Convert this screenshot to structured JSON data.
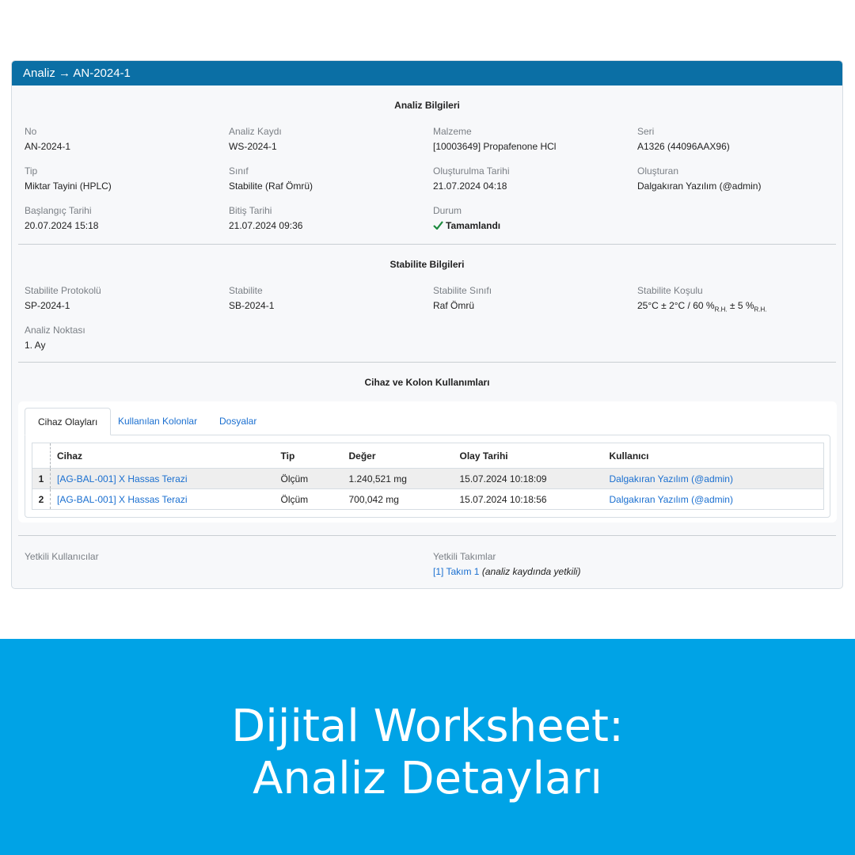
{
  "header": {
    "title": "Analiz → AN-2024-1"
  },
  "analysis_info": {
    "section_title": "Analiz Bilgileri",
    "fields": [
      {
        "label": "No",
        "value": "AN-2024-1"
      },
      {
        "label": "Analiz Kaydı",
        "value": "WS-2024-1"
      },
      {
        "label": "Malzeme",
        "value": "[10003649] Propafenone HCl"
      },
      {
        "label": "Seri",
        "value": "A1326 (44096AAX96)"
      },
      {
        "label": "Tip",
        "value": "Miktar Tayini (HPLC)"
      },
      {
        "label": "Sınıf",
        "value": "Stabilite (Raf Ömrü)"
      },
      {
        "label": "Oluşturulma Tarihi",
        "value": "21.07.2024 04:18"
      },
      {
        "label": "Oluşturan",
        "value": "Dalgakıran Yazılım (@admin)"
      },
      {
        "label": "Başlangıç Tarihi",
        "value": "20.07.2024 15:18"
      },
      {
        "label": "Bitiş Tarihi",
        "value": "21.07.2024 09:36"
      },
      {
        "label": "Durum",
        "value": "Tamamlandı",
        "status_color": "#1c8a3e"
      }
    ]
  },
  "stability_info": {
    "section_title": "Stabilite Bilgileri",
    "fields": [
      {
        "label": "Stabilite Protokolü",
        "value": "SP-2024-1"
      },
      {
        "label": "Stabilite",
        "value": "SB-2024-1"
      },
      {
        "label": "Stabilite Sınıfı",
        "value": "Raf Ömrü"
      },
      {
        "label": "Stabilite Koşulu",
        "value_a": "25°C ± 2°C / 60 %",
        "sub_a": "R.H.",
        "value_b": " ± 5 %",
        "sub_b": "R.H."
      },
      {
        "label": "Analiz Noktası",
        "value": "1. Ay"
      }
    ]
  },
  "usage": {
    "section_title": "Cihaz ve Kolon Kullanımları",
    "tabs": [
      "Cihaz Olayları",
      "Kullanılan Kolonlar",
      "Dosyalar"
    ],
    "columns": [
      "Cihaz",
      "Tip",
      "Değer",
      "Olay Tarihi",
      "Kullanıcı"
    ],
    "rows": [
      {
        "idx": "1",
        "device": "[AG-BAL-001] X Hassas Terazi",
        "type": "Ölçüm",
        "value": "1.240,521 mg",
        "date": "15.07.2024 10:18:09",
        "user": "Dalgakıran Yazılım (@admin)"
      },
      {
        "idx": "2",
        "device": "[AG-BAL-001] X Hassas Terazi",
        "type": "Ölçüm",
        "value": "700,042 mg",
        "date": "15.07.2024 10:18:56",
        "user": "Dalgakıran Yazılım (@admin)"
      }
    ]
  },
  "authorization": {
    "users_label": "Yetkili Kullanıcılar",
    "teams_label": "Yetkili Takımlar",
    "team_link": "[1] Takım 1",
    "team_note": "(analiz kaydında yetkili)"
  },
  "banner": {
    "line1": "Dijital Worksheet:",
    "line2": "Analiz Detayları"
  },
  "colors": {
    "header": "#0b6fa5",
    "banner": "#00a3e6",
    "link": "#1a6fd0",
    "success": "#1c8a3e"
  },
  "icons": {
    "status": "check-icon"
  }
}
